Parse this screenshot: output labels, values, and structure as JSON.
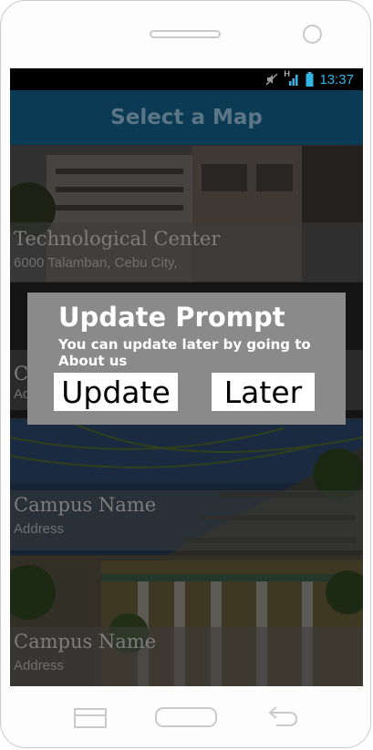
{
  "status_bar": {
    "icons": [
      "mute-icon",
      "signal-h-icon",
      "battery-icon"
    ],
    "network_label": "H",
    "time": "13:37"
  },
  "app_bar": {
    "title": "Select a Map"
  },
  "campuses": [
    {
      "name": "Technological Center",
      "address": "6000 Talamban, Cebu City,"
    },
    {
      "name": "C",
      "address": "Ad"
    },
    {
      "name": "Campus Name",
      "address": "Address"
    },
    {
      "name": "Campus Name",
      "address": "Address"
    }
  ],
  "dialog": {
    "title": "Update Prompt",
    "message": "You can update later by going to About us",
    "update_label": "Update",
    "later_label": "Later"
  },
  "nav_keys": [
    "menu-icon",
    "home-icon",
    "back-icon"
  ],
  "colors": {
    "status_accent": "#33b5e5",
    "app_bar": "#0b3a55",
    "dialog_bg": "#8a8a8a",
    "button_bg": "#ffffff"
  }
}
